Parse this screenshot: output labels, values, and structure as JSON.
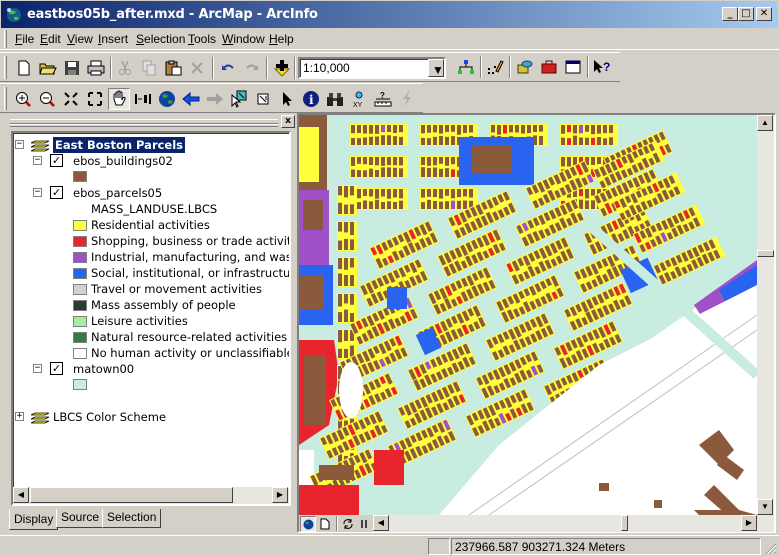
{
  "window": {
    "title": "eastbos05b_after.mxd - ArcMap - ArcInfo",
    "minimize_label": "_",
    "maximize_label": "□",
    "close_label": "✕"
  },
  "menubar": {
    "items": [
      {
        "label": "File",
        "mnemonic": "F"
      },
      {
        "label": "Edit",
        "mnemonic": "E"
      },
      {
        "label": "View",
        "mnemonic": "V"
      },
      {
        "label": "Insert",
        "mnemonic": "I"
      },
      {
        "label": "Selection",
        "mnemonic": "S"
      },
      {
        "label": "Tools",
        "mnemonic": "T"
      },
      {
        "label": "Window",
        "mnemonic": "W"
      },
      {
        "label": "Help",
        "mnemonic": "H"
      }
    ]
  },
  "standard_toolbar": {
    "buttons": [
      "new-document",
      "open",
      "save",
      "print",
      "cut",
      "copy",
      "paste",
      "delete",
      "undo",
      "redo",
      "add-data"
    ],
    "scale_value": "1:10,000",
    "buttons_right": [
      "editor-toolbar",
      "editor",
      "arccatalog",
      "arctoolbox",
      "command-line",
      "whats-this"
    ]
  },
  "tools_toolbar": {
    "buttons": [
      "zoom-in",
      "zoom-out",
      "fixed-zoom-in",
      "fixed-zoom-out",
      "pan",
      "full-extent",
      "globe",
      "back-extent",
      "forward-extent",
      "select-features",
      "clear-selection",
      "select-elements",
      "identify",
      "find",
      "go-to-xy",
      "measure",
      "hyperlink"
    ],
    "active": "pan"
  },
  "toc": {
    "close_label": "x",
    "data_frame": "East Boston Parcels",
    "layers": [
      {
        "name": "ebos_buildings02",
        "checked": true,
        "expanded": true,
        "symbol_color": "#8b5a3c"
      },
      {
        "name": "ebos_parcels05",
        "checked": true,
        "expanded": true,
        "field": "MASS_LANDUSE.LBCS",
        "classes": [
          {
            "label": "Residential activities",
            "color": "#ffff3c"
          },
          {
            "label": "Shopping, business or trade activities",
            "color": "#e8242c"
          },
          {
            "label": "Industrial, manufacturing, and waste-related activities",
            "color": "#a050c8"
          },
          {
            "label": "Social, institutional, or infrastructure-related activities",
            "color": "#2864f0"
          },
          {
            "label": "Travel or movement activities",
            "color": "#d2d2d2"
          },
          {
            "label": "Mass assembly of people",
            "color": "#2a3a34"
          },
          {
            "label": "Leisure activities",
            "color": "#a0f0a0"
          },
          {
            "label": "Natural resource-related activities",
            "color": "#3c7a3c"
          },
          {
            "label": "No human activity or unclassifiable activity",
            "color": "#ffffff"
          }
        ]
      },
      {
        "name": "matown00",
        "checked": true,
        "expanded": true,
        "symbol_color": "#c8ece0"
      }
    ],
    "second_data_frame": "LBCS Color Scheme",
    "tabs": [
      {
        "label": "Display",
        "active": true
      },
      {
        "label": "Source",
        "active": false
      },
      {
        "label": "Selection",
        "active": false
      }
    ]
  },
  "map": {
    "colors": {
      "street": "#c8ece0",
      "building": "#8b5a3c",
      "residential": "#ffff3c",
      "commercial": "#e8242c",
      "industrial": "#a050c8",
      "institutional": "#2864f0",
      "open": "#ffffff",
      "leisure": "#a0f0a0"
    }
  },
  "layout_bar": {
    "buttons": [
      "data-view",
      "layout-view",
      "refresh",
      "pause-drawing"
    ]
  },
  "status": {
    "coordinates": "237966.587  903271.324 Meters"
  }
}
